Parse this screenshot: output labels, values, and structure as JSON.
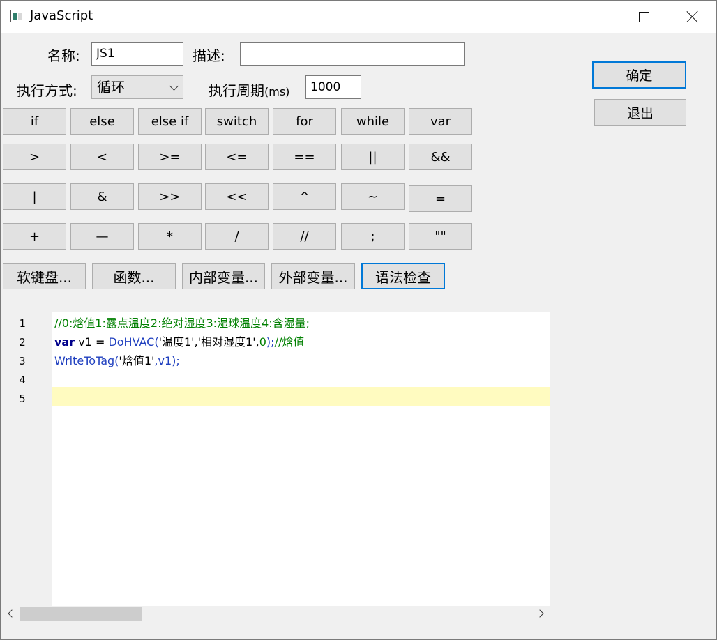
{
  "window": {
    "title": "JavaScript",
    "icon": "app-window-icon"
  },
  "form": {
    "name_label": "名称:",
    "name_value": "JS1",
    "desc_label": "描述:",
    "desc_value": "",
    "exec_mode_label": "执行方式:",
    "exec_mode_value": "循环",
    "period_label": "执行周期",
    "period_unit": "(ms)",
    "period_value": "1000"
  },
  "actions": {
    "ok": "确定",
    "exit": "退出"
  },
  "keypad": {
    "row1": [
      "if",
      "else",
      "else if",
      "switch",
      "for",
      "while",
      "var"
    ],
    "row2": [
      ">",
      "<",
      ">=",
      "<=",
      "==",
      "||",
      "&&"
    ],
    "row3": [
      "|",
      "&",
      ">>",
      "<<",
      "^",
      "~",
      "="
    ],
    "row4": [
      "+",
      "—",
      "*",
      "/",
      "//",
      ";",
      "\"\""
    ]
  },
  "tools": [
    "软键盘...",
    "函数...",
    "内部变量...",
    "外部变量...",
    "语法检查"
  ],
  "editor": {
    "line_numbers": [
      "1",
      "2",
      "3",
      "4",
      "5"
    ],
    "line1": {
      "comment": "//0:焓值1:露点温度2:绝对湿度3:湿球温度4:含湿量;"
    },
    "line2": {
      "kw": "var",
      "var": " v1 = ",
      "fn": "DoHVAC(",
      "s1": "'温度1'",
      "comma1": ",",
      "s2": "'相对湿度1'",
      "comma2": ",",
      "num": "0",
      "end": ");",
      "comment": "//焓值"
    },
    "line3": {
      "fn": "WriteToTag(",
      "s1": "'焓值1'",
      "rest": ",v1);"
    },
    "current_line": "5"
  }
}
